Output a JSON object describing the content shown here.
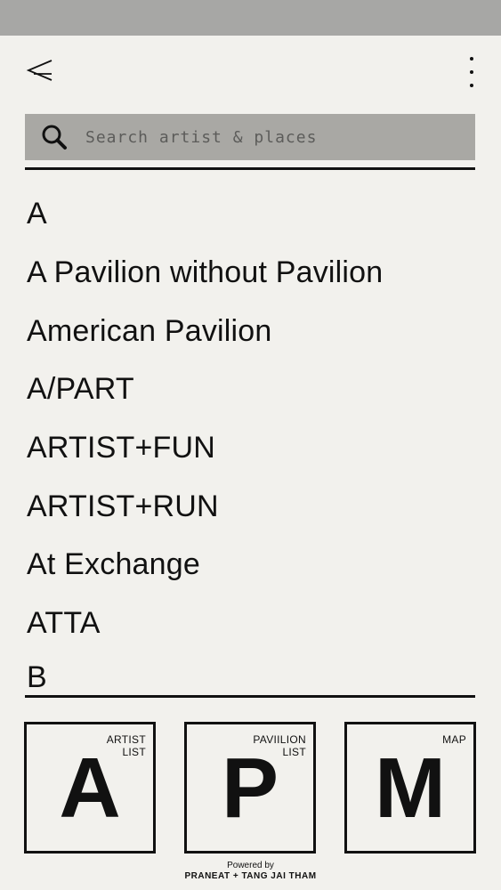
{
  "header": {
    "back_icon": "back-arrow-icon",
    "menu_icon": "more-vertical-icon"
  },
  "search": {
    "placeholder": "Search artist & places",
    "icon": "search-icon"
  },
  "list": {
    "section_a": "A",
    "items": [
      "A Pavilion without Pavilion",
      "American Pavilion",
      "A/PART",
      "ARTIST+FUN",
      "ARTIST+RUN",
      "At Exchange",
      "ATTA"
    ],
    "section_b": "B"
  },
  "tiles": [
    {
      "label_1": "ARTIST",
      "label_2": "LIST",
      "letter": "A"
    },
    {
      "label_1": "PAVIILION",
      "label_2": "LIST",
      "letter": "P"
    },
    {
      "label_1": "MAP",
      "label_2": "",
      "letter": "M"
    }
  ],
  "footer": {
    "powered_by": "Powered by",
    "brand": "PRANEAT + TANG JAI THAM"
  },
  "colors": {
    "background": "#f2f1ed",
    "status_bar": "#a7a7a5",
    "search_fill": "#a9a8a4",
    "text": "#111111"
  }
}
